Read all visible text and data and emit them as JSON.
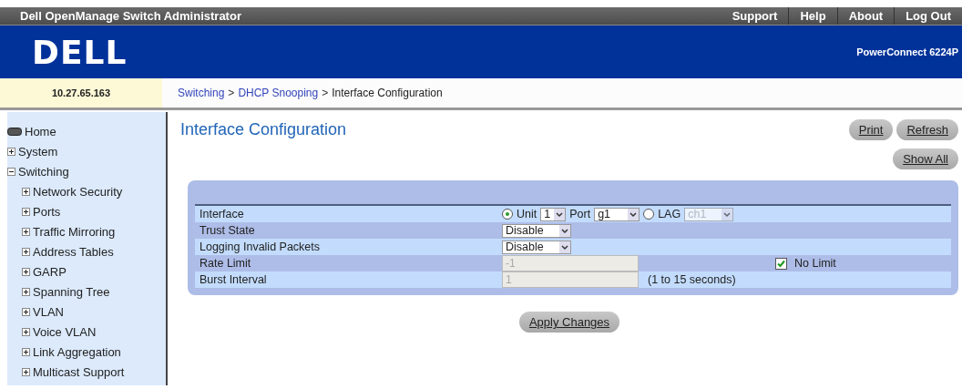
{
  "title_bar": {
    "title": "Dell OpenManage Switch Administrator",
    "links": [
      "Support",
      "Help",
      "About",
      "Log Out"
    ]
  },
  "header": {
    "logo": "DELL",
    "product": "PowerConnect 6224P"
  },
  "address": "10.27.65.163",
  "breadcrumb": [
    {
      "label": "Switching",
      "link": true
    },
    {
      "label": "DHCP Snooping",
      "link": true
    },
    {
      "label": "Interface Configuration",
      "link": false
    }
  ],
  "separator": ">",
  "sidebar": {
    "items": [
      {
        "label": "Home",
        "kind": "home"
      },
      {
        "label": "System",
        "kind": "folder",
        "expanded": false
      },
      {
        "label": "Switching",
        "kind": "folder",
        "expanded": true,
        "children": [
          {
            "label": "Network Security",
            "kind": "folder",
            "expanded": false
          },
          {
            "label": "Ports",
            "kind": "folder",
            "expanded": false
          },
          {
            "label": "Traffic Mirroring",
            "kind": "folder",
            "expanded": false
          },
          {
            "label": "Address Tables",
            "kind": "folder",
            "expanded": false
          },
          {
            "label": "GARP",
            "kind": "folder",
            "expanded": false
          },
          {
            "label": "Spanning Tree",
            "kind": "folder",
            "expanded": false
          },
          {
            "label": "VLAN",
            "kind": "folder",
            "expanded": false
          },
          {
            "label": "Voice VLAN",
            "kind": "folder",
            "expanded": false
          },
          {
            "label": "Link Aggregation",
            "kind": "folder",
            "expanded": false
          },
          {
            "label": "Multicast Support",
            "kind": "folder",
            "expanded": false
          }
        ]
      }
    ]
  },
  "page": {
    "title": "Interface Configuration",
    "buttons": [
      "Print",
      "Refresh"
    ],
    "show_all": "Show All"
  },
  "form": {
    "rows": [
      {
        "kind": "interface",
        "label": "Interface",
        "unit_radio": {
          "label": "Unit",
          "selected": true
        },
        "unit_select": "1",
        "port_label": "Port",
        "port_select": "g1",
        "lag_radio": {
          "label": "LAG",
          "selected": false
        },
        "lag_select": {
          "value": "ch1",
          "disabled": true
        }
      },
      {
        "kind": "select",
        "label": "Trust State",
        "value": "Disable"
      },
      {
        "kind": "select",
        "label": "Logging Invalid Packets",
        "value": "Disable"
      },
      {
        "kind": "input",
        "label": "Rate Limit",
        "value": "-1",
        "disabled": true,
        "extra": {
          "kind": "checkbox",
          "label": "No Limit",
          "checked": true
        }
      },
      {
        "kind": "input",
        "label": "Burst Interval",
        "value": "1",
        "disabled": true,
        "extra": {
          "kind": "hint",
          "text": "(1 to 15 seconds)"
        }
      }
    ]
  },
  "apply_button": "Apply Changes"
}
